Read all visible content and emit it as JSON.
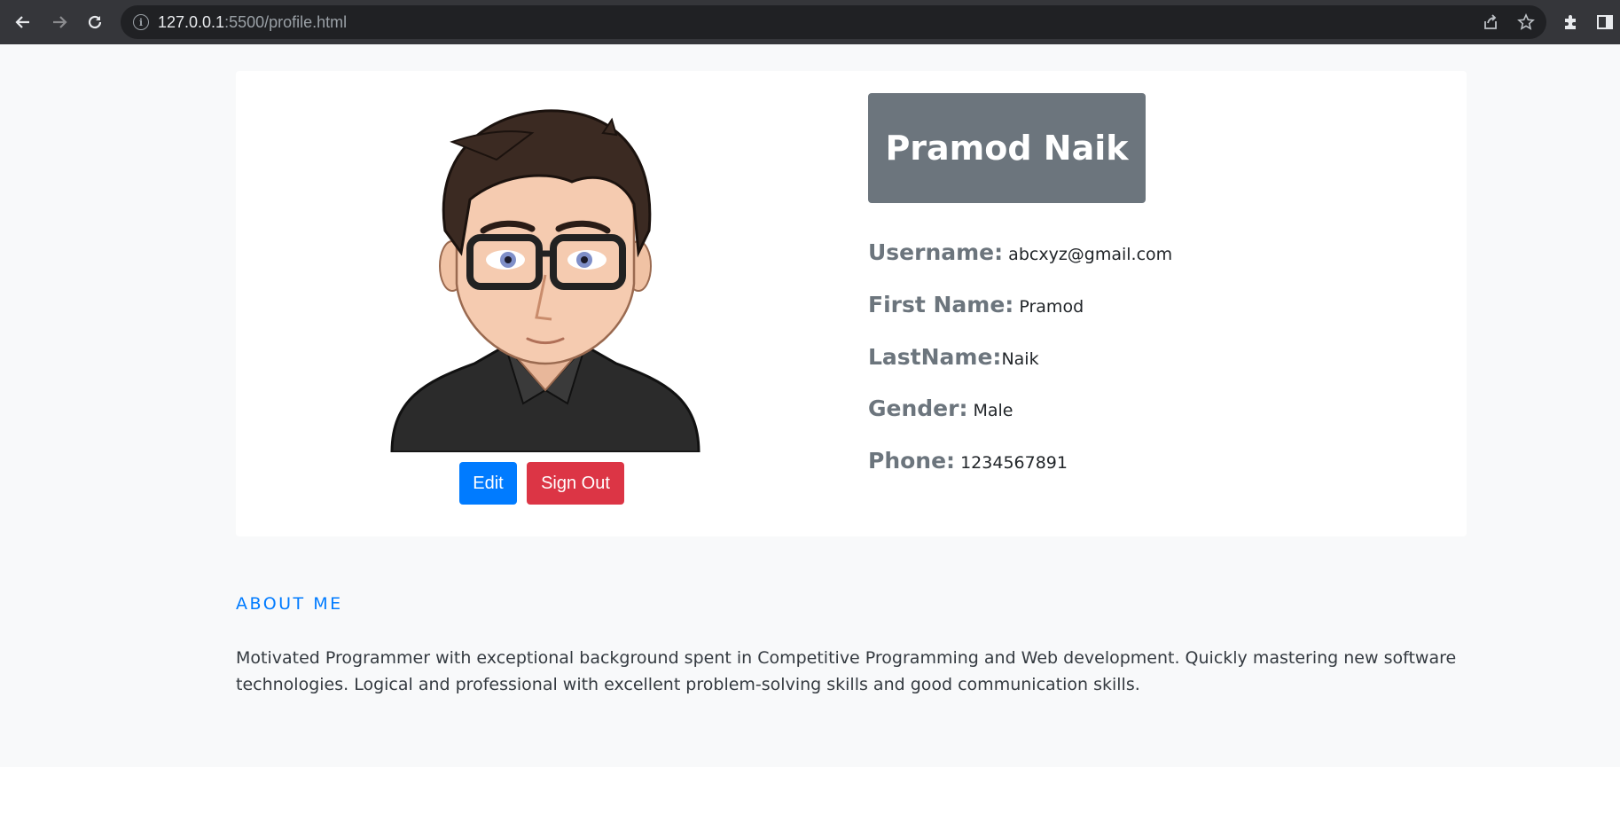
{
  "browser": {
    "url_host": "127.0.0.1",
    "url_path": ":5500/profile.html"
  },
  "profile": {
    "full_name": "Pramod Naik",
    "fields": [
      {
        "label": "Username:",
        "value": " abcxyz@gmail.com"
      },
      {
        "label": "First Name:",
        "value": " Pramod"
      },
      {
        "label": "LastName:",
        "value": "Naik"
      },
      {
        "label": "Gender:",
        "value": " Male"
      },
      {
        "label": "Phone:",
        "value": " 1234567891"
      }
    ],
    "edit_label": "Edit",
    "signout_label": "Sign Out"
  },
  "about": {
    "title": "ABOUT ME",
    "text": "Motivated Programmer with exceptional background spent in Competitive Programming and Web development. Quickly mastering new software technologies. Logical and professional with excellent problem-solving skills and good communication skills."
  },
  "colors": {
    "primary": "#007bff",
    "danger": "#dc3545",
    "secondary": "#6c757d",
    "page_bg": "#f8f9fa"
  },
  "icons": [
    "back-arrow-icon",
    "forward-arrow-icon",
    "reload-icon",
    "info-icon",
    "share-icon",
    "star-icon",
    "extensions-icon",
    "side-panel-icon"
  ]
}
